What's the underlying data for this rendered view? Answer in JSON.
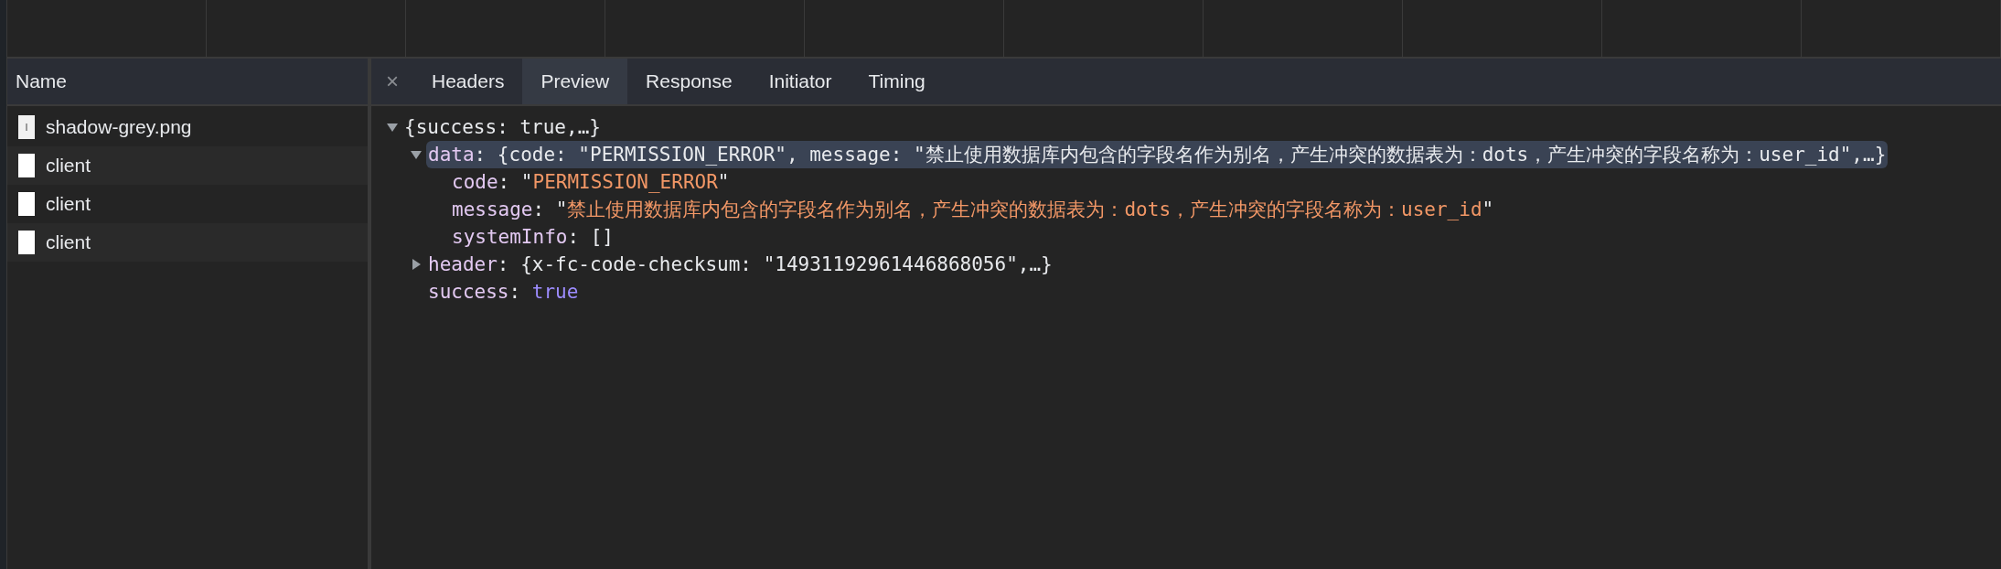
{
  "requests": {
    "column_header": "Name",
    "items": [
      {
        "name": "shadow-grey.png",
        "kind": "image"
      },
      {
        "name": "client",
        "kind": "document"
      },
      {
        "name": "client",
        "kind": "document"
      },
      {
        "name": "client",
        "kind": "document"
      }
    ]
  },
  "details": {
    "close": "×",
    "tabs": [
      {
        "label": "Headers",
        "selected": false
      },
      {
        "label": "Preview",
        "selected": true
      },
      {
        "label": "Response",
        "selected": false
      },
      {
        "label": "Initiator",
        "selected": false
      },
      {
        "label": "Timing",
        "selected": false
      }
    ]
  },
  "preview": {
    "separator": ":",
    "tree": [
      {
        "kind": "object",
        "summary": "{success: true,…}",
        "expanded": true,
        "selected": false,
        "children": [
          {
            "kind": "object",
            "key": "data",
            "summary": "{code: \"PERMISSION_ERROR\", message: \"禁止使用数据库内包含的字段名作为别名，产生冲突的数据表为：dots，产生冲突的字段名称为：user_id\",…}",
            "expanded": true,
            "selected": true,
            "children": [
              {
                "kind": "string",
                "key": "code",
                "quote": "\"",
                "value": "PERMISSION_ERROR"
              },
              {
                "kind": "string",
                "key": "message",
                "quote": "\"",
                "value": "禁止使用数据库内包含的字段名作为别名，产生冲突的数据表为：dots，产生冲突的字段名称为：user_id"
              },
              {
                "kind": "array",
                "key": "systemInfo",
                "summary": "[]"
              }
            ]
          },
          {
            "kind": "object",
            "key": "header",
            "summary": "{x-fc-code-checksum: \"14931192961446868056\",…}",
            "expanded": false,
            "selected": false
          },
          {
            "kind": "boolean",
            "key": "success",
            "value": "true"
          }
        ]
      }
    ]
  }
}
